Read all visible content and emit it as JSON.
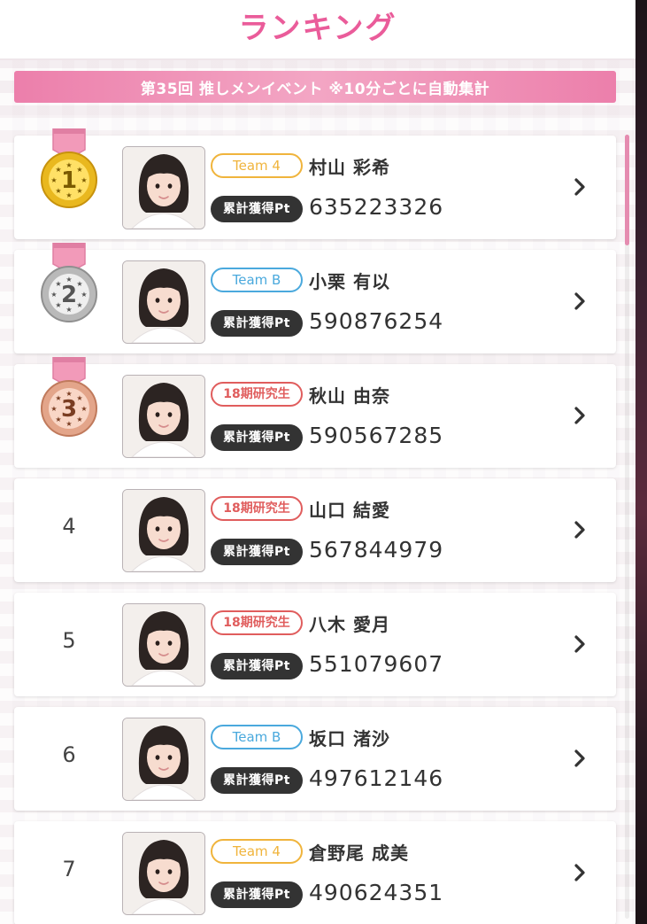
{
  "header": {
    "title": "ランキング"
  },
  "event": {
    "banner": "第35回 推しメンイベント ※10分ごとに自動集計"
  },
  "colors": {
    "brand_pink": "#ea5c9a",
    "team4": "#f0b43c",
    "teamB": "#4aa9dd",
    "kenkyusei": "#e05d5d"
  },
  "pt_label": "累計獲得Pt",
  "rankings": [
    {
      "rank": "1",
      "medal": "gold",
      "team": "Team 4",
      "team_type": "team4",
      "name": "村山 彩希",
      "points": "635223326"
    },
    {
      "rank": "2",
      "medal": "silver",
      "team": "Team B",
      "team_type": "teamb",
      "name": "小栗 有以",
      "points": "590876254"
    },
    {
      "rank": "3",
      "medal": "bronze",
      "team": "18期研究生",
      "team_type": "ken",
      "name": "秋山 由奈",
      "points": "590567285"
    },
    {
      "rank": "4",
      "medal": "",
      "team": "18期研究生",
      "team_type": "ken",
      "name": "山口 結愛",
      "points": "567844979"
    },
    {
      "rank": "5",
      "medal": "",
      "team": "18期研究生",
      "team_type": "ken",
      "name": "八木 愛月",
      "points": "551079607"
    },
    {
      "rank": "6",
      "medal": "",
      "team": "Team B",
      "team_type": "teamb",
      "name": "坂口 渚沙",
      "points": "497612146"
    },
    {
      "rank": "7",
      "medal": "",
      "team": "Team 4",
      "team_type": "team4",
      "name": "倉野尾 成美",
      "points": "490624351"
    }
  ]
}
